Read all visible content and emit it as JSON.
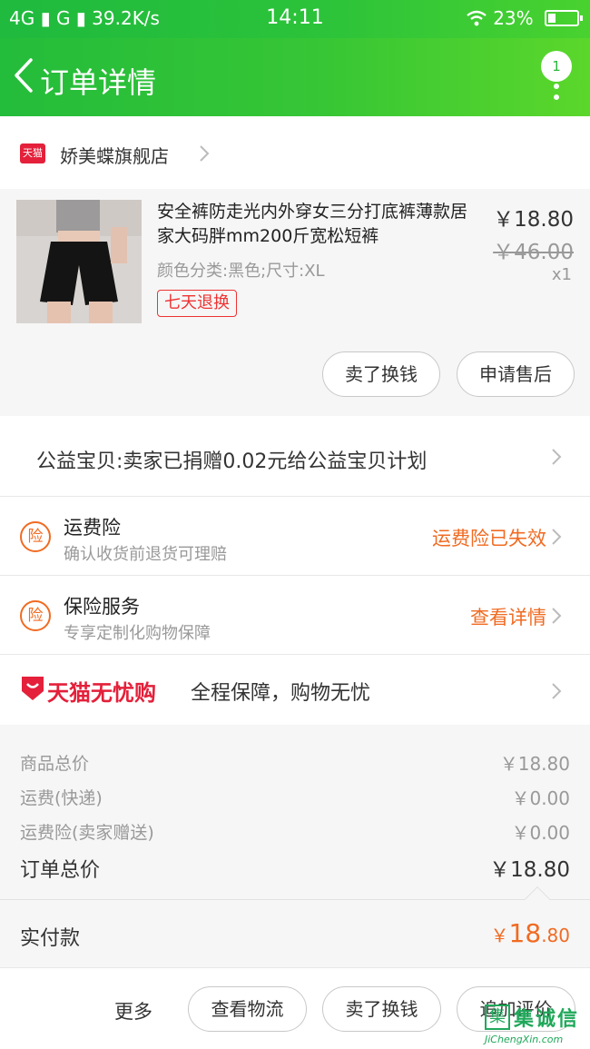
{
  "status_bar": {
    "left": "4G ▮ G ▮ 39.2K/s",
    "time": "14:11",
    "battery": "23%"
  },
  "nav": {
    "title": "订单详情",
    "badge_count": "1"
  },
  "shop": {
    "logo_text": "天猫",
    "name": "娇美蝶旗舰店"
  },
  "item": {
    "title": "安全裤防走光内外穿女三分打底裤薄款居家大码胖mm200斤宽松短裤",
    "spec": "颜色分类:黑色;尺寸:XL",
    "tag": "七天退换",
    "price": "￥18.80",
    "original_price": "￥46.00",
    "quantity": "x1",
    "actions": [
      "卖了换钱",
      "申请售后"
    ]
  },
  "charity": {
    "text": "公益宝贝:卖家已捐赠0.02元给公益宝贝计划"
  },
  "insurance": [
    {
      "icon": "险",
      "title": "运费险",
      "subtitle": "确认收货前退货可理赔",
      "status": "运费险已失效"
    },
    {
      "icon": "险",
      "title": "保险服务",
      "subtitle": "专享定制化购物保障",
      "status": "查看详情"
    }
  ],
  "worry_free": {
    "brand": "天猫无忧购",
    "text": "全程保障，购物无忧"
  },
  "summary": {
    "rows": [
      {
        "label": "商品总价",
        "value": "￥18.80"
      },
      {
        "label": "运费(快递)",
        "value": "￥0.00"
      },
      {
        "label": "运费险(卖家赠送)",
        "value": "￥0.00"
      }
    ],
    "total_label": "订单总价",
    "total_value": "￥18.80",
    "paid_label": "实付款",
    "paid_symbol": "￥",
    "paid_int": "18",
    "paid_dec": ".80"
  },
  "bottom_bar": {
    "more": "更多",
    "buttons": [
      "查看物流",
      "卖了换钱",
      "追加评价"
    ]
  },
  "watermark": {
    "text": "集诚信",
    "site": "JiChengXin.com"
  },
  "colors": {
    "nav_green": "#2cc33a",
    "accent_orange": "#f06b22",
    "tmall_red": "#e4203a"
  }
}
